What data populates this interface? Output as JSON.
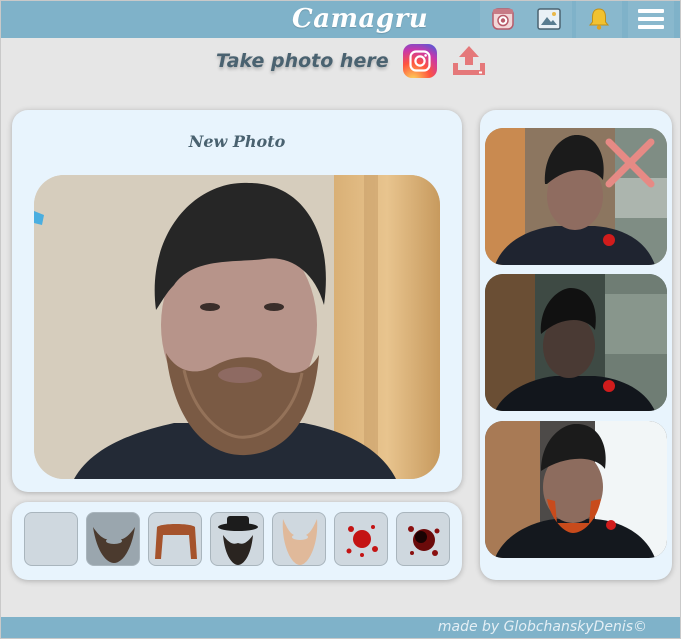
{
  "header": {
    "logo": "Camagru",
    "nav": [
      {
        "name": "camera-nav-icon"
      },
      {
        "name": "gallery-nav-icon"
      },
      {
        "name": "notifications-bell-icon"
      },
      {
        "name": "menu-hamburger-icon"
      }
    ]
  },
  "subheader": {
    "take_photo_label": "Take photo here",
    "camera_icon": "instagram-camera-icon",
    "upload_icon": "upload-icon"
  },
  "main": {
    "title": "New Photo",
    "preview": "webcam-preview"
  },
  "stickers": [
    {
      "name": "sticker-empty"
    },
    {
      "name": "sticker-dark-beard"
    },
    {
      "name": "sticker-red-mustache"
    },
    {
      "name": "sticker-rabbi-hat-beard"
    },
    {
      "name": "sticker-blond-beard"
    },
    {
      "name": "sticker-blood-splatter"
    },
    {
      "name": "sticker-dark-blood-splatter"
    }
  ],
  "gallery": {
    "delete_icon": "delete-x-icon",
    "thumbs": [
      {
        "name": "gallery-photo-1"
      },
      {
        "name": "gallery-photo-2"
      },
      {
        "name": "gallery-photo-3"
      }
    ]
  },
  "footer": {
    "credit": "made by GlobchanskyDenis©"
  },
  "colors": {
    "header_bg": "#7fb2c9",
    "card_bg": "#e8f4fd",
    "page_bg": "#e6e6e6",
    "title_text": "#4a6270"
  }
}
